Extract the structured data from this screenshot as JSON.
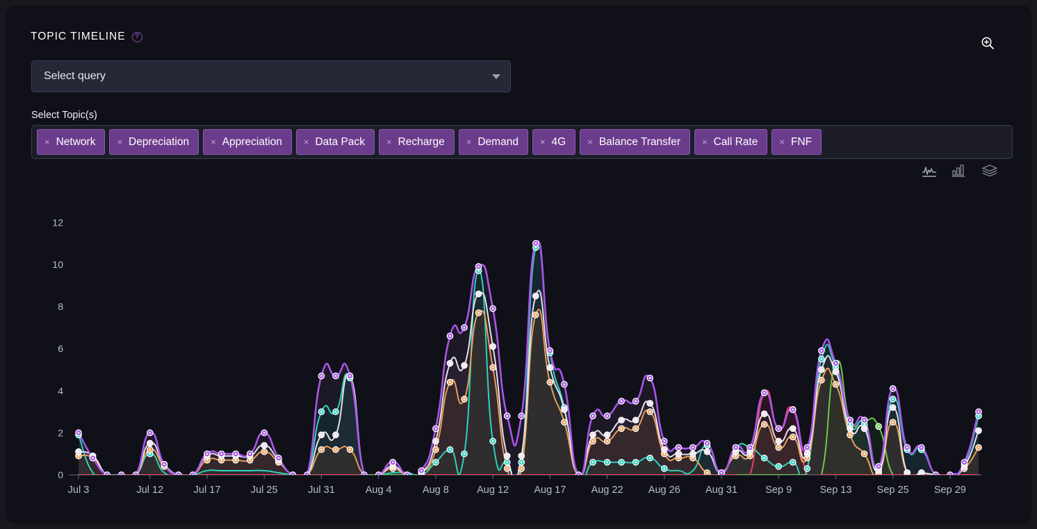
{
  "panel": {
    "title": "TOPIC TIMELINE",
    "help_icon": "question-circle-icon",
    "zoom_icon": "zoom-in-icon"
  },
  "query_select": {
    "value": "Select query",
    "placeholder": "Select query",
    "caret_icon": "chevron-down-icon"
  },
  "topics": {
    "label": "Select Topic(s)",
    "remove_glyph": "×",
    "items": [
      {
        "label": "Network"
      },
      {
        "label": "Depreciation"
      },
      {
        "label": "Appreciation"
      },
      {
        "label": "Data Pack"
      },
      {
        "label": "Recharge"
      },
      {
        "label": "Demand"
      },
      {
        "label": "4G"
      },
      {
        "label": "Balance Transfer"
      },
      {
        "label": "Call Rate"
      },
      {
        "label": "FNF"
      }
    ]
  },
  "chart_modes": [
    {
      "name": "line-chart-icon",
      "active": true
    },
    {
      "name": "bar-chart-icon",
      "active": false
    },
    {
      "name": "stacked-layers-icon",
      "active": false
    }
  ],
  "colors": {
    "panel_bg": "#0f1018",
    "page_bg": "#17171d",
    "accent_purple": "#a855e8",
    "tag_bg": "#6b3b8c",
    "tag_border": "#8e5ab0",
    "field_bg": "#252836",
    "field_border": "#3a3e52",
    "axis_text": "#b8bcd0",
    "area_fill": "#40302a"
  },
  "chart_data": {
    "type": "area",
    "title": "Topic Timeline",
    "xlabel": "",
    "ylabel": "",
    "ylim": [
      0,
      12.8
    ],
    "yticks": [
      0,
      2,
      4,
      6,
      8,
      10,
      12
    ],
    "grid": false,
    "legend": "none",
    "x_tick_labels": [
      "Jul 3",
      "Jul 12",
      "Jul 17",
      "Jul 25",
      "Jul 31",
      "Aug 4",
      "Aug 8",
      "Aug 12",
      "Aug 17",
      "Aug 22",
      "Aug 26",
      "Aug 31",
      "Sep 9",
      "Sep 13",
      "Sep 25",
      "Sep 29"
    ],
    "x_tick_indices": [
      0,
      5,
      9,
      13,
      17,
      21,
      25,
      29,
      33,
      37,
      41,
      45,
      49,
      53,
      57,
      61
    ],
    "n_points": 64,
    "series": [
      {
        "name": "Network",
        "color": "#a855e8",
        "values": [
          2,
          0.8,
          0,
          0,
          0,
          2,
          0.5,
          0,
          0,
          1,
          1,
          1,
          1,
          2,
          0.8,
          0,
          0,
          4.7,
          4.7,
          4.7,
          0,
          0,
          0.6,
          0,
          0.2,
          2.2,
          6.6,
          7,
          9.9,
          7.9,
          2.8,
          2.8,
          11,
          5.9,
          4.3,
          0,
          2.8,
          2.8,
          3.5,
          3.5,
          4.6,
          1.6,
          1.3,
          1.3,
          1.5,
          0.1,
          1.3,
          1.3,
          3.9,
          2.2,
          3.1,
          1.3,
          5.9,
          5.3,
          2.6,
          2.6,
          0.4,
          4.1,
          1.3,
          1.3,
          0,
          0,
          0.6,
          3.0
        ]
      },
      {
        "name": "Depreciation",
        "color": "#e8e0ee",
        "values": [
          1.1,
          0.9,
          0,
          0,
          0,
          1.5,
          0.5,
          0,
          0,
          0.9,
          0.9,
          0.9,
          0.9,
          1.4,
          0.7,
          0,
          0,
          1.9,
          1.9,
          4.7,
          0,
          0,
          0.4,
          0,
          0.1,
          1.6,
          5.3,
          5.2,
          8.6,
          6.1,
          0.9,
          0.9,
          8.5,
          5.1,
          3.1,
          0,
          1.9,
          1.9,
          2.6,
          2.6,
          3.4,
          1.2,
          1.0,
          1.0,
          1.1,
          0.1,
          1.1,
          1.1,
          2.9,
          1.6,
          2.2,
          1.0,
          5.0,
          4.9,
          2.2,
          2.2,
          0.2,
          3.2,
          0.1,
          0.1,
          0,
          0,
          0.4,
          2.1
        ]
      },
      {
        "name": "Appreciation",
        "color": "#e9a05a",
        "values": [
          0.9,
          0.8,
          0,
          0,
          0,
          1.2,
          0.4,
          0,
          0,
          0.7,
          0.7,
          0.7,
          0.7,
          1.1,
          0.6,
          0,
          0,
          1.2,
          1.2,
          1.2,
          0,
          0,
          0.3,
          0,
          0.1,
          1.2,
          4.4,
          3.6,
          7.7,
          5.1,
          0.3,
          0.3,
          7.6,
          4.4,
          2.5,
          0,
          1.6,
          1.6,
          2.2,
          2.2,
          3.0,
          1.0,
          0.8,
          0.8,
          0.1,
          0.1,
          0.9,
          0.9,
          2.4,
          1.3,
          1.8,
          0.8,
          4.5,
          4.3,
          1.9,
          1.0,
          0.1,
          2.5,
          0.1,
          0.1,
          0,
          0,
          0.3,
          1.3
        ]
      },
      {
        "name": "Data Pack",
        "color": "#2dd4bf",
        "values": [
          1.9,
          0.1,
          0,
          0,
          0,
          1.0,
          0.1,
          0,
          0,
          0.2,
          0.2,
          0.2,
          0.2,
          0.2,
          0.1,
          0,
          0,
          3.0,
          3.0,
          4.6,
          0,
          0,
          0.1,
          0.1,
          0.0,
          0.6,
          1.2,
          1.0,
          9.7,
          1.6,
          0.6,
          0.6,
          10.8,
          5.8,
          3.2,
          0,
          0.6,
          0.6,
          0.6,
          0.6,
          0.8,
          0.3,
          0.2,
          0.2,
          1.4,
          0.1,
          1.3,
          1.3,
          0.8,
          0.4,
          0.6,
          0.3,
          5.5,
          5.1,
          2.4,
          2.4,
          0.3,
          3.6,
          1.2,
          1.2,
          0,
          0,
          0.5,
          2.8
        ]
      },
      {
        "name": "Recharge",
        "color": "#ef4056",
        "values": [
          0,
          0,
          0,
          0,
          0,
          0,
          0,
          0,
          0,
          0,
          0,
          0,
          0,
          0,
          0,
          0,
          0,
          0,
          0,
          0,
          0,
          0,
          0.6,
          0,
          0,
          0,
          0,
          0,
          0,
          0,
          0,
          0,
          0,
          0,
          0,
          0,
          0,
          0,
          0,
          0,
          0,
          0,
          0,
          0,
          0,
          0,
          0,
          0,
          3.9,
          2.2,
          3.1,
          0,
          0,
          0,
          0,
          0,
          0,
          0,
          0,
          0,
          0,
          0,
          0,
          0
        ]
      },
      {
        "name": "Demand",
        "color": "#6ec94a",
        "values": [
          0,
          0,
          0,
          0,
          0,
          0,
          0,
          0,
          0,
          0,
          0,
          0,
          0,
          0,
          0,
          0,
          0,
          0,
          0,
          0,
          0,
          0,
          0,
          0,
          0,
          0,
          0,
          0,
          0,
          0,
          0,
          0,
          0,
          0,
          0,
          0,
          0,
          0,
          0,
          0,
          0,
          0,
          0,
          0,
          0,
          0,
          0,
          0,
          0,
          0,
          0,
          0,
          0,
          5.3,
          2.6,
          2.6,
          2.3,
          0,
          0,
          0,
          0,
          0,
          0,
          0
        ]
      }
    ]
  }
}
